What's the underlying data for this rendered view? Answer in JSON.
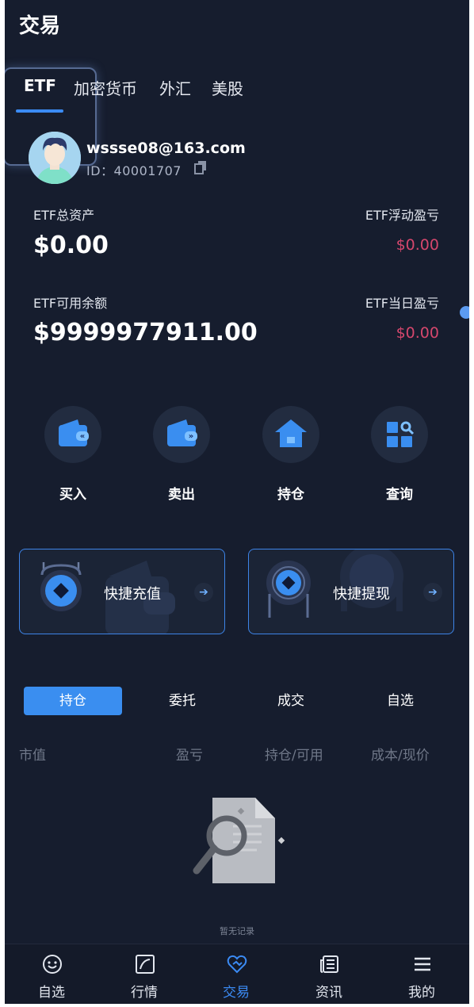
{
  "header": {
    "title": "交易"
  },
  "tabs": [
    "ETF",
    "加密货币",
    "外汇",
    "美股"
  ],
  "user": {
    "email": "wssse08@163.com",
    "id": "ID：40001707"
  },
  "stats": {
    "total_assets_label": "ETF总资产",
    "total_assets_value": "$0.00",
    "floating_pnl_label": "ETF浮动盈亏",
    "floating_pnl_value": "$0.00",
    "available_label": "ETF可用余额",
    "available_value": "$9999977911.00",
    "daily_pnl_label": "ETF当日盈亏",
    "daily_pnl_value": "$0.00"
  },
  "actions": [
    "买入",
    "卖出",
    "持仓",
    "查询"
  ],
  "quick": {
    "deposit": "快捷充值",
    "withdraw": "快捷提现"
  },
  "position_tabs": [
    "持仓",
    "委托",
    "成交",
    "自选"
  ],
  "columns": [
    "市值",
    "盈亏",
    "持仓/可用",
    "成本/现价"
  ],
  "empty": {
    "text": "暂无记录"
  },
  "nav": [
    "自选",
    "行情",
    "交易",
    "资讯",
    "我的"
  ],
  "colors": {
    "accent": "#3b8bf4",
    "background": "#161d2e",
    "loss": "#d5476d"
  }
}
